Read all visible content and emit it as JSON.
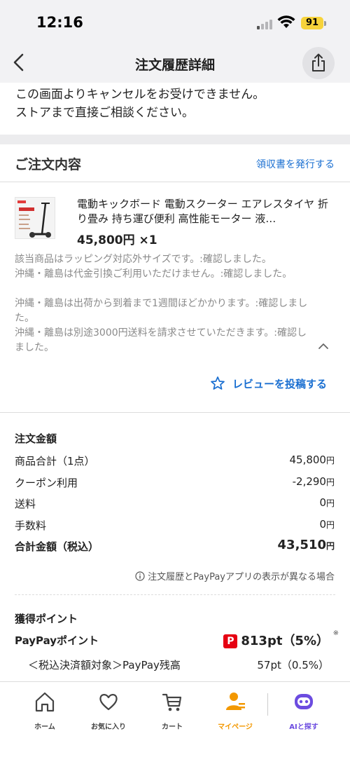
{
  "status_bar": {
    "time": "12:16",
    "battery": "91"
  },
  "nav": {
    "title": "注文履歴詳細"
  },
  "notice": {
    "line1": "この画面よりキャンセルをお受けできません。",
    "line2": "ストアまで直接ご相談ください。"
  },
  "order_contents": {
    "title": "ご注文内容",
    "receipt_link": "領収書を発行する",
    "product": {
      "name": "電動キックボード 電動スクーター エアレスタイヤ 折り畳み 持ち運び便利 高性能モーター 液…",
      "price": "45,800円 ×1"
    },
    "options": [
      "該当商品はラッピング対応外サイズです。:確認しました。",
      "沖縄・離島は代金引換ご利用いただけません。:確認しました。",
      "沖縄・離島は出荷から到着まで1週間ほどかかります。:確認しました。",
      "沖縄・離島は別途3000円送料を請求させていただきます。:確認しました。"
    ],
    "review_button": "レビューを投稿する"
  },
  "order_amount": {
    "title": "注文金額",
    "rows": [
      {
        "label": "商品合計（1点）",
        "value": "45,800",
        "unit": "円"
      },
      {
        "label": "クーポン利用",
        "value": "-2,290",
        "unit": "円"
      },
      {
        "label": "送料",
        "value": "0",
        "unit": "円"
      },
      {
        "label": "手数料",
        "value": "0",
        "unit": "円"
      }
    ],
    "total_label": "合計金額（税込）",
    "total_value": "43,510",
    "total_unit": "円",
    "info_note": "注文履歴とPayPayアプリの表示が異なる場合"
  },
  "points": {
    "title": "獲得ポイント",
    "paypay_label": "PayPayポイント",
    "paypay_value": "813pt（5%）",
    "asterisk": "※",
    "sub_label": "＜税込決済額対象＞PayPay残高",
    "sub_value": "57pt（0.5%）"
  },
  "tab_bar": {
    "tabs": [
      "ホーム",
      "お気に入り",
      "カート",
      "マイページ",
      "AIと探す"
    ]
  },
  "colors": {
    "link_blue": "#1a6fd1",
    "mypage_orange": "#f39800",
    "ai_purple": "#6c4ce0",
    "paypay_red": "#e60012",
    "battery_yellow": "#f7d33a"
  }
}
